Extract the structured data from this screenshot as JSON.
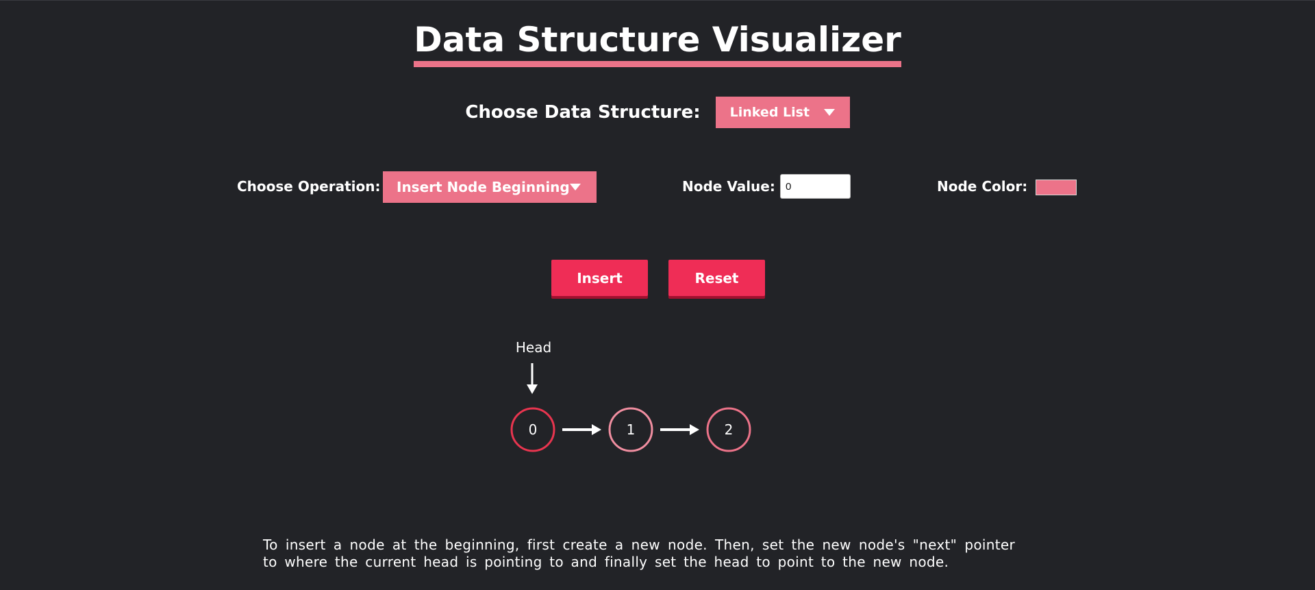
{
  "header": {
    "title": "Data Structure Visualizer"
  },
  "structure_select": {
    "label": "Choose Data Structure:",
    "selected": "Linked List"
  },
  "operation_select": {
    "label": "Choose Operation:",
    "selected": "Insert Node Beginning"
  },
  "node_value": {
    "label": "Node Value:",
    "value": "0"
  },
  "node_color": {
    "label": "Node Color:",
    "value": "#ec7389"
  },
  "buttons": {
    "insert_label": "Insert",
    "reset_label": "Reset"
  },
  "visualization": {
    "head_label": "Head",
    "nodes": [
      {
        "value": "0",
        "stroke": "#e8354f"
      },
      {
        "value": "1",
        "stroke": "#f08ea0"
      },
      {
        "value": "2",
        "stroke": "#ec7389"
      }
    ]
  },
  "description": "To insert a node at the beginning, first create a new node. Then, set the new node's \"next\" pointer to where the current head is pointing to and finally set the head to point to the new node.",
  "colors": {
    "background": "#222327",
    "accent": "#ec7389",
    "button": "#ef2d56"
  }
}
